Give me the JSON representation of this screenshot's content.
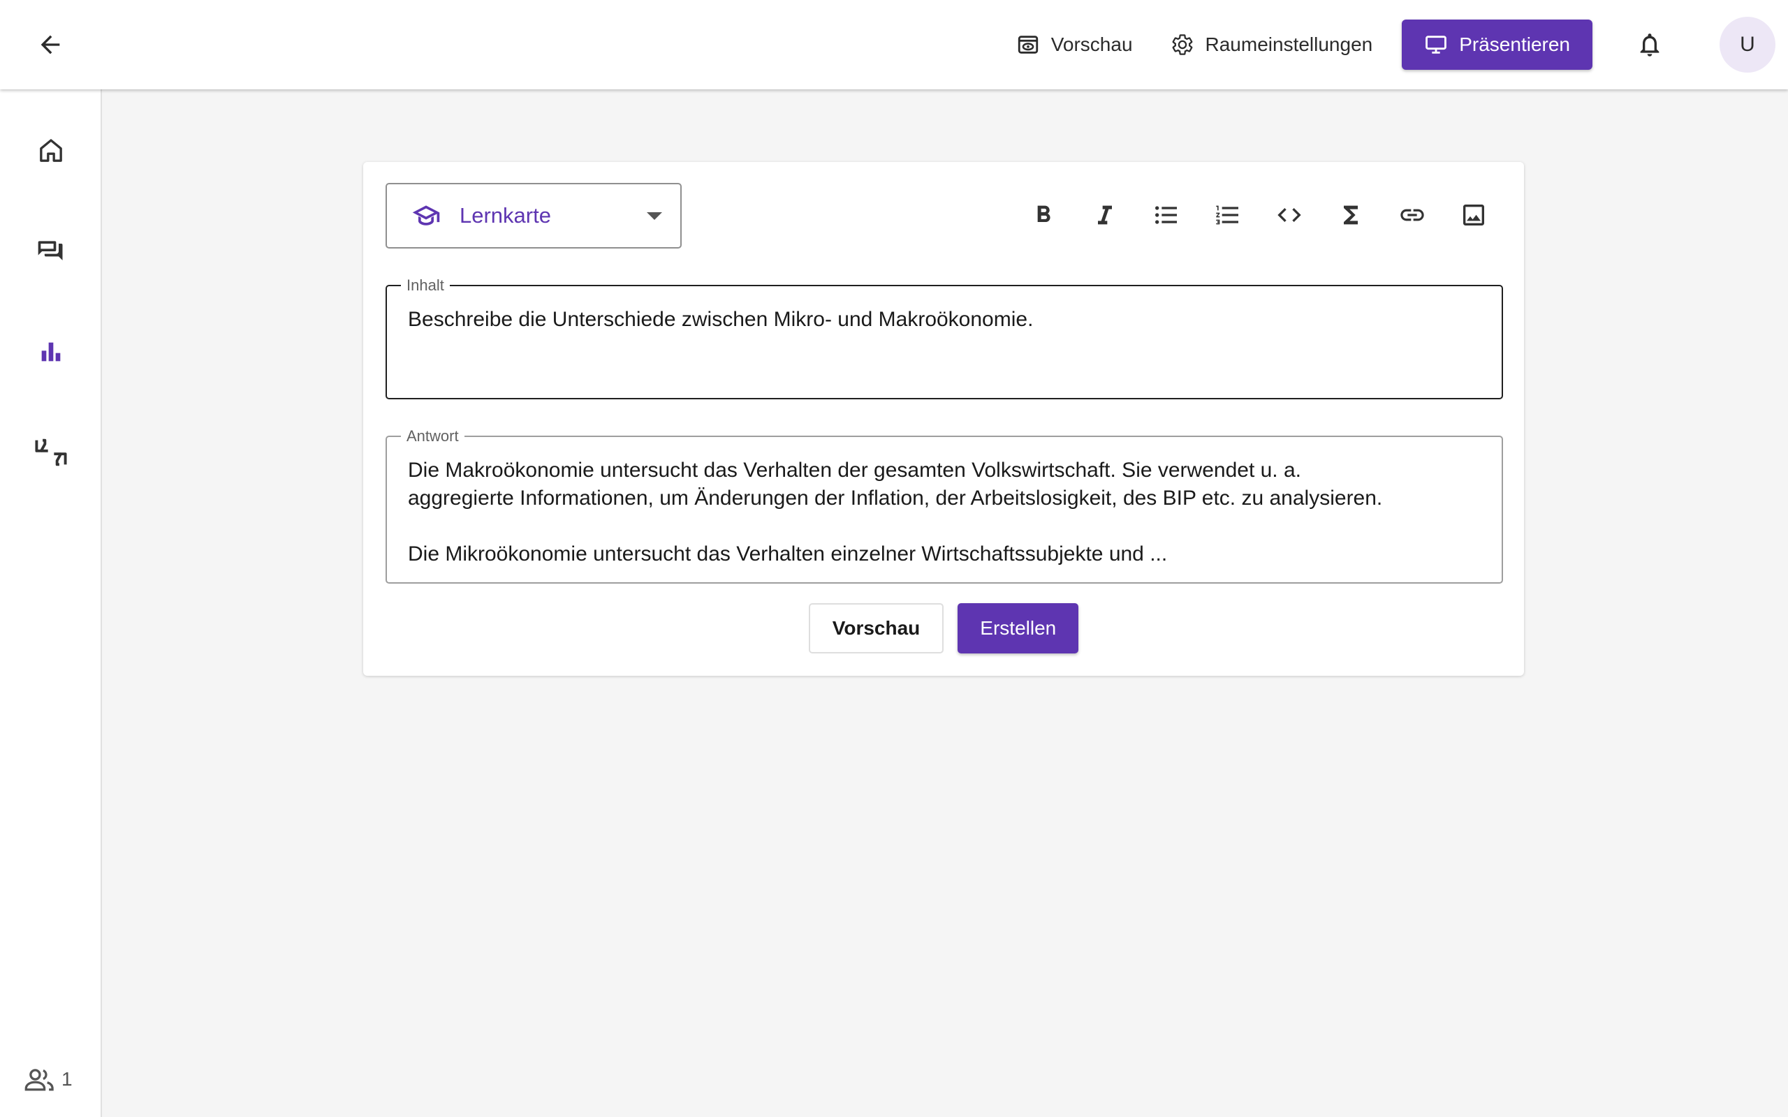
{
  "header": {
    "back_icon": "arrow-left-icon",
    "preview_label": "Vorschau",
    "room_settings_label": "Raumeinstellungen",
    "present_label": "Präsentieren",
    "avatar_initial": "U"
  },
  "sidebar": {
    "items": [
      {
        "icon": "home-icon",
        "active": false
      },
      {
        "icon": "forum-icon",
        "active": false
      },
      {
        "icon": "bar-chart-icon",
        "active": true
      },
      {
        "icon": "feedback-icon",
        "active": false
      }
    ],
    "participants_count": "1"
  },
  "editor": {
    "content_type": "Lernkarte",
    "toolbar": [
      "bold-icon",
      "italic-icon",
      "bullet-list-icon",
      "numbered-list-icon",
      "code-icon",
      "sigma-icon",
      "link-icon",
      "image-icon"
    ],
    "content_label": "Inhalt",
    "content_value": "Beschreibe die Unterschiede zwischen Mikro- und Makroökonomie.",
    "answer_label": "Antwort",
    "answer_value": "Die Makroökonomie untersucht das Verhalten der gesamten Volkswirtschaft. Sie verwendet u. a.\naggregierte Informationen, um Änderungen der Inflation, der Arbeitslosigkeit, des BIP etc. zu analysieren.\n\nDie Mikroökonomie untersucht das Verhalten einzelner Wirtschaftssubjekte und ...",
    "preview_button": "Vorschau",
    "create_button": "Erstellen"
  },
  "colors": {
    "accent": "#5e35b1",
    "accent_light": "#ede7f6"
  }
}
